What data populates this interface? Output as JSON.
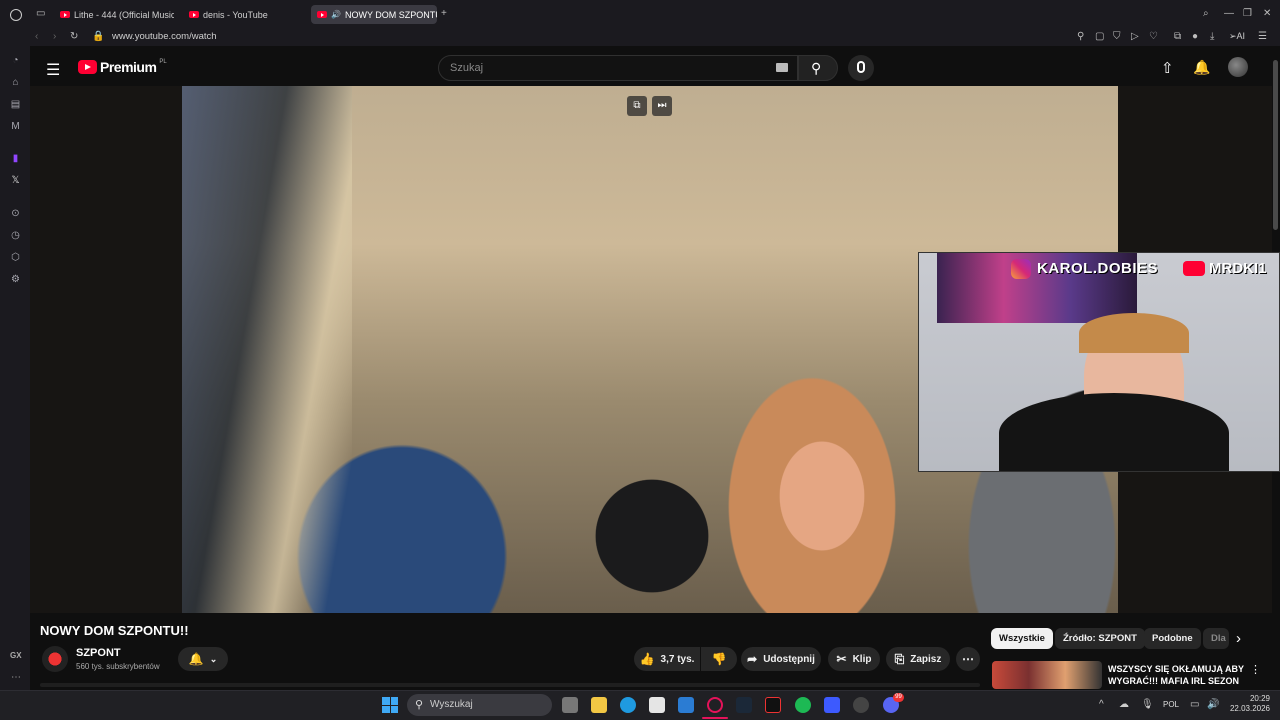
{
  "browser": {
    "tabs": [
      {
        "label": "Lithe - 444 (Official Music"
      },
      {
        "label": "denis - YouTube"
      },
      {
        "label": "NOWY DOM SZPONTU"
      }
    ],
    "url": "www.youtube.com/watch",
    "ai_label": "AI",
    "sidebar_gx_label": "GX"
  },
  "youtube": {
    "logo_text": "Premium",
    "logo_region": "PL",
    "search_placeholder": "Szukaj",
    "video": {
      "title": "NOWY DOM SZPONTU!!",
      "channel_name": "SZPONT",
      "subscribers": "560 tys. subskrybentów",
      "likes": "3,7 tys.",
      "share_label": "Udostępnij",
      "clip_label": "Klip",
      "save_label": "Zapisz"
    },
    "overlay": {
      "instagram_handle": "KAROL.DOBIES",
      "youtube_handle": "MRDKI1"
    },
    "chips": [
      "Wszystkie",
      "Źródło: SZPONT",
      "Podobne",
      "Dla"
    ],
    "recommendation": {
      "title_line1": "WSZYSCY SIĘ OKŁAMUJĄ ABY",
      "title_line2": "WYGRAĆ!!! MAFIA IRL SEZON ..."
    }
  },
  "taskbar": {
    "search_placeholder": "Wyszukaj",
    "language": "POL",
    "time": "20:29",
    "date": "22.03.2026",
    "discord_badge": "99"
  },
  "colors": {
    "youtube_red": "#ff0033",
    "background": "#0f0f0f",
    "chip_bg": "#272727"
  }
}
